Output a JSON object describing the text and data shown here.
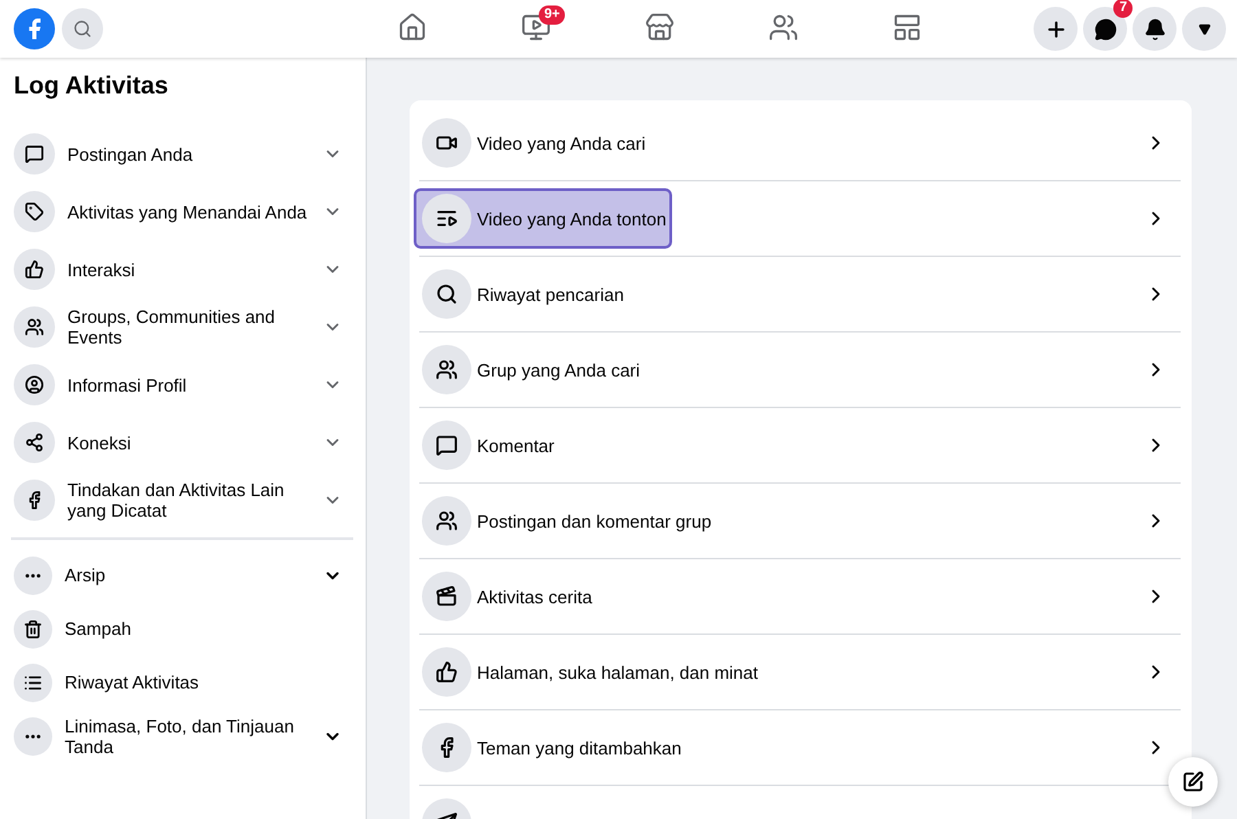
{
  "top_bar": {
    "nav": [
      {
        "kind": "home",
        "selected": false
      },
      {
        "kind": "video",
        "selected": false,
        "badge": "9+"
      },
      {
        "kind": "marketplace",
        "selected": false
      },
      {
        "kind": "groups",
        "selected": false
      },
      {
        "kind": "gaming",
        "selected": false
      }
    ],
    "actions": [
      {
        "kind": "plus"
      },
      {
        "kind": "messenger",
        "badge": "7"
      },
      {
        "kind": "bell"
      },
      {
        "kind": "caret"
      }
    ]
  },
  "sidebar": {
    "title": "Log Aktivitas",
    "sections": [
      [
        {
          "label": "Postingan Anda",
          "expandable": true
        },
        {
          "label": "Aktivitas yang Menandai Anda",
          "expandable": true
        },
        {
          "label": "Interaksi",
          "expandable": true
        },
        {
          "label": "Groups, Communities and Events",
          "expandable": true
        },
        {
          "label": "Informasi Profil",
          "expandable": true
        },
        {
          "label": "Koneksi",
          "expandable": true
        },
        {
          "label": "Tindakan dan Aktivitas Lain yang Dicatat",
          "expandable": true
        }
      ],
      [
        {
          "label": "Arsip",
          "expandable": true
        },
        {
          "label": "Sampah",
          "expandable": false
        },
        {
          "label": "Riwayat Aktivitas",
          "expandable": false
        },
        {
          "label": "Linimasa, Foto, dan Tinjauan Tanda",
          "expandable": true
        }
      ]
    ]
  },
  "list": {
    "items": [
      {
        "label": "Video yang Anda cari",
        "selected": false
      },
      {
        "label": "Video yang Anda tonton",
        "selected": true
      },
      {
        "label": "Riwayat pencarian",
        "selected": false
      },
      {
        "label": "Grup yang Anda cari",
        "selected": false
      },
      {
        "label": "Komentar",
        "selected": false
      },
      {
        "label": "Postingan dan komentar grup",
        "selected": false
      },
      {
        "label": "Aktivitas cerita",
        "selected": false
      },
      {
        "label": "Halaman, suka halaman, dan minat",
        "selected": false
      },
      {
        "label": "Teman yang ditambahkan",
        "selected": false
      },
      {
        "selected": false
      }
    ]
  }
}
